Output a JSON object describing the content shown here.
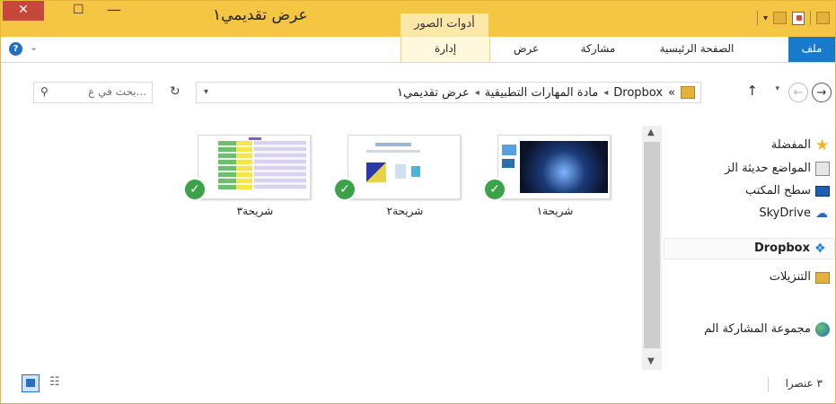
{
  "window": {
    "title": "عرض تقديمي١",
    "contextual_tab": "أدوات الصور",
    "close_glyph": "✕",
    "maximize_glyph": "☐",
    "minimize_glyph": "—"
  },
  "ribbon": {
    "tabs": {
      "file": "ملف",
      "home": "الصفحة الرئيسية",
      "share": "مشاركة",
      "view": "عرض",
      "manage": "إدارة"
    },
    "help_glyph": "?",
    "collapse_glyph": "⌄"
  },
  "address": {
    "breadcrumb": [
      "Dropbox",
      "مادة المهارات التطبيقية",
      "عرض تقديمي١"
    ],
    "overflow": "«",
    "separator": "◂"
  },
  "search": {
    "placeholder": "بحث في ع..."
  },
  "nav_pane": {
    "items": [
      {
        "label": "المفضلة",
        "icon": "star-icon"
      },
      {
        "label": "المواضع حديثة الز",
        "icon": "recent-places-icon"
      },
      {
        "label": "سطح المكتب",
        "icon": "desktop-icon"
      },
      {
        "label": "SkyDrive",
        "icon": "skydrive-icon"
      },
      {
        "label": "Dropbox",
        "icon": "dropbox-icon",
        "selected": true
      },
      {
        "label": "التنزيلات",
        "icon": "downloads-folder-icon"
      },
      {
        "label": "مجموعة المشاركة الم",
        "icon": "homegroup-icon"
      }
    ]
  },
  "files": [
    {
      "name": "شريحة١",
      "status": "synced"
    },
    {
      "name": "شريحة٢",
      "status": "synced"
    },
    {
      "name": "شريحة٣",
      "status": "synced"
    }
  ],
  "status_bar": {
    "item_count": "٣ عنصرا"
  },
  "colors": {
    "titlebar": "#f5c544",
    "file_tab": "#1979ca",
    "sync_check": "#3aa34a",
    "close_button": "#c7473c"
  }
}
